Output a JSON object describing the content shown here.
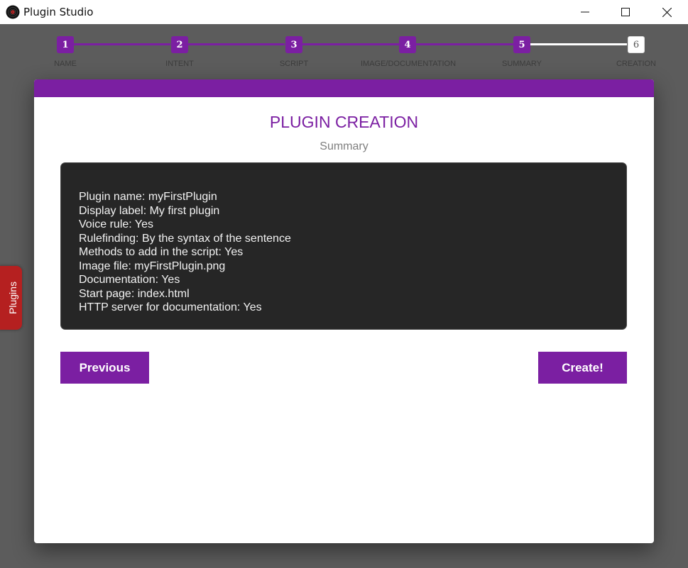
{
  "window": {
    "title": "Plugin Studio",
    "icon": "vinyl-record-icon",
    "controls": [
      "minimize-icon",
      "maximize-icon",
      "close-icon"
    ]
  },
  "stepper": {
    "steps": [
      {
        "number": "1",
        "label": "NAME"
      },
      {
        "number": "2",
        "label": "INTENT"
      },
      {
        "number": "3",
        "label": "SCRIPT"
      },
      {
        "number": "4",
        "label": "IMAGE/DOCUMENTATION"
      },
      {
        "number": "5",
        "label": "SUMMARY"
      },
      {
        "number": "6",
        "label": "CREATION"
      }
    ],
    "active_step": 6
  },
  "card": {
    "title": "PLUGIN CREATION",
    "subtitle": "Summary",
    "summary_lines": [
      "Plugin name: myFirstPlugin",
      "Display label: My first plugin",
      "Voice rule: Yes",
      "Rulefinding: By the syntax of the sentence",
      "Methods to add in the script: Yes",
      "Image file: myFirstPlugin.png",
      "Documentation: Yes",
      "Start page: index.html",
      "HTTP server for documentation: Yes"
    ],
    "previous_label": "Previous",
    "create_label": "Create!"
  },
  "side_tab": {
    "label": "Plugins"
  },
  "colors": {
    "accent": "#7b1fa2",
    "side_tab": "#b52020",
    "summary_bg": "#262626",
    "backdrop": "#5c5c5c"
  }
}
